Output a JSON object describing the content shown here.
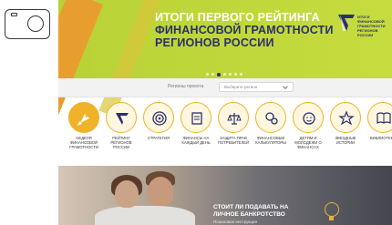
{
  "hero": {
    "title_lines": [
      "ИТОГИ ПЕРВОГО РЕЙТИНГА",
      "ФИНАНСОВОЙ ГРАМОТНОСТИ",
      "РЕГИОНОВ РОССИИ"
    ],
    "logo_text_lines": [
      "ИТОГИ",
      "ФИНАНСОВОЙ",
      "ГРАМОТНОСТИ",
      "РЕГИОНОВ",
      "РОССИИ"
    ],
    "carousel_dots": 7,
    "carousel_active": 2
  },
  "filter": {
    "label": "Регионы проекта",
    "select_value": "Выберите регион"
  },
  "categories": [
    {
      "label": "Неделя\nфинансовой\nграмотности",
      "icon": "rocket-icon"
    },
    {
      "label": "Рейтинг\nрегионов\nРоссии",
      "icon": "logo-v-icon"
    },
    {
      "label": "Стратегия",
      "icon": "target-icon"
    },
    {
      "label": "Финансы на\nкаждый день",
      "icon": "notepad-icon"
    },
    {
      "label": "Защита прав\nпотребителей",
      "icon": "scales-icon"
    },
    {
      "label": "Финансовые\nкалькуляторы",
      "icon": "gears-icon"
    },
    {
      "label": "Детям и\nмолодежи о\nфинансах",
      "icon": "child-face-icon"
    },
    {
      "label": "Звездные\nистории",
      "icon": "star-icon"
    },
    {
      "label": "Библиотека",
      "icon": "book-icon"
    }
  ],
  "banner": {
    "title_lines": [
      "СТОИТ ЛИ ПОДАВАТЬ НА",
      "ЛИЧНОЕ БАНКРОТСТВО"
    ],
    "subtitle": "Пошаговая инструкция"
  },
  "colors": {
    "hero_bg": "#c2d93b",
    "accent_orange": "#f0b229",
    "navy": "#2a2f6b"
  }
}
